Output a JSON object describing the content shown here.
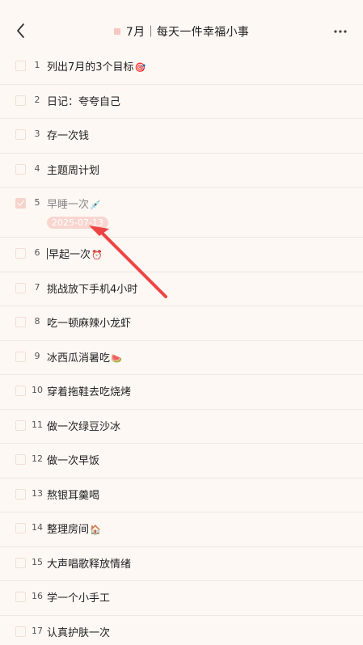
{
  "header": {
    "title": "7月｜每天一件幸福小事",
    "back_icon": "chevron-left-icon",
    "more_icon": "more-horizontal-icon",
    "accent_color": "#f6c8c0"
  },
  "tasks": [
    {
      "num": "1",
      "label": "列出7月的3个目标",
      "emoji": "🎯",
      "done": false
    },
    {
      "num": "2",
      "label": "日记：夸夸自己",
      "emoji": "",
      "done": false
    },
    {
      "num": "3",
      "label": "存一次钱",
      "emoji": "",
      "done": false
    },
    {
      "num": "4",
      "label": "主题周计划",
      "emoji": "",
      "done": false
    },
    {
      "num": "5",
      "label": "早睡一次",
      "emoji": "💉",
      "done": true,
      "date": "2025-07-13"
    },
    {
      "num": "6",
      "label": "早起一次",
      "emoji": "⏰",
      "done": false
    },
    {
      "num": "7",
      "label": "挑战放下手机4小时",
      "emoji": "",
      "done": false
    },
    {
      "num": "8",
      "label": "吃一顿麻辣小龙虾",
      "emoji": "",
      "done": false
    },
    {
      "num": "9",
      "label": "冰西瓜消暑吃",
      "emoji": "🍉",
      "done": false
    },
    {
      "num": "10",
      "label": "穿着拖鞋去吃烧烤",
      "emoji": "",
      "done": false
    },
    {
      "num": "11",
      "label": "做一次绿豆沙冰",
      "emoji": "",
      "done": false
    },
    {
      "num": "12",
      "label": "做一次早饭",
      "emoji": "",
      "done": false
    },
    {
      "num": "13",
      "label": "熬银耳羹喝",
      "emoji": "",
      "done": false
    },
    {
      "num": "14",
      "label": "整理房间",
      "emoji": "🏠",
      "done": false
    },
    {
      "num": "15",
      "label": "大声唱歌释放情绪",
      "emoji": "",
      "done": false
    },
    {
      "num": "16",
      "label": "学一个小手工",
      "emoji": "",
      "done": false
    },
    {
      "num": "17",
      "label": "认真护肤一次",
      "emoji": "",
      "done": false
    }
  ]
}
